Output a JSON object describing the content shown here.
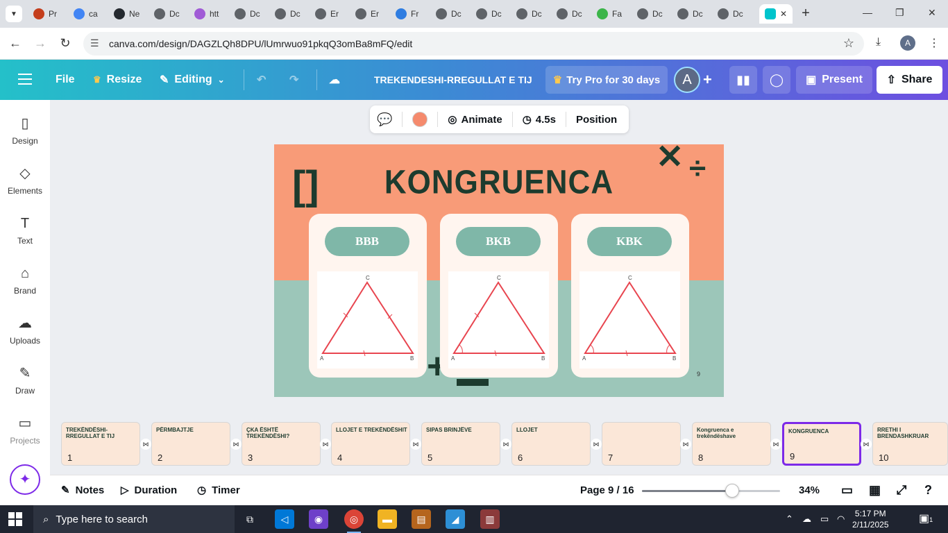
{
  "browser": {
    "tabs": [
      {
        "title": "Pr",
        "icon": "powerpoint-icon",
        "color": "#c43e1c"
      },
      {
        "title": "ca",
        "icon": "google-icon",
        "color": "#4285f4"
      },
      {
        "title": "Ne",
        "icon": "github-icon",
        "color": "#24292f"
      },
      {
        "title": "Dc",
        "icon": "globe-icon",
        "color": "#5f6368"
      },
      {
        "title": "htt",
        "icon": "triangle-icon",
        "color": "#a05bd6"
      },
      {
        "title": "Dc",
        "icon": "globe-icon",
        "color": "#5f6368"
      },
      {
        "title": "Dc",
        "icon": "globe-icon",
        "color": "#5f6368"
      },
      {
        "title": "Er",
        "icon": "globe-icon",
        "color": "#5f6368"
      },
      {
        "title": "Er",
        "icon": "globe-icon",
        "color": "#5f6368"
      },
      {
        "title": "Fr",
        "icon": "heart-icon",
        "color": "#2f7de1"
      },
      {
        "title": "Dc",
        "icon": "globe-icon",
        "color": "#5f6368"
      },
      {
        "title": "Dc",
        "icon": "globe-icon",
        "color": "#5f6368"
      },
      {
        "title": "Dc",
        "icon": "globe-icon",
        "color": "#5f6368"
      },
      {
        "title": "Dc",
        "icon": "globe-icon",
        "color": "#5f6368"
      },
      {
        "title": "Fa",
        "icon": "am-icon",
        "color": "#3cb54a"
      },
      {
        "title": "Dc",
        "icon": "globe-icon",
        "color": "#5f6368"
      },
      {
        "title": "Dc",
        "icon": "globe-icon",
        "color": "#5f6368"
      },
      {
        "title": "Dc",
        "icon": "globe-icon",
        "color": "#5f6368"
      }
    ],
    "active_tab_icon": "canva-icon",
    "url": "canva.com/design/DAGZLQh8DPU/lUmrwuo91pkqQ3omBa8mFQ/edit",
    "profile_initial": "A"
  },
  "header": {
    "file": "File",
    "resize": "Resize",
    "editing": "Editing",
    "title": "TREKENDESHI-RREGULLAT E TIJ",
    "try_pro": "Try Pro for 30 days",
    "avatar": "A",
    "present": "Present",
    "share": "Share",
    "accent": "#7d2ae8"
  },
  "sidebar": {
    "items": [
      {
        "label": "Design",
        "icon": "design-icon"
      },
      {
        "label": "Elements",
        "icon": "elements-icon"
      },
      {
        "label": "Text",
        "icon": "text-icon"
      },
      {
        "label": "Brand",
        "icon": "brand-icon"
      },
      {
        "label": "Uploads",
        "icon": "uploads-icon"
      },
      {
        "label": "Draw",
        "icon": "draw-icon"
      },
      {
        "label": "Projects",
        "icon": "projects-icon"
      }
    ]
  },
  "context_toolbar": {
    "animate": "Animate",
    "duration": "4.5s",
    "position": "Position",
    "fill_color": "#f58a6d"
  },
  "slide": {
    "title": "KONGRUENCA",
    "cards": [
      {
        "label": "BBB",
        "vertices": [
          "A",
          "B",
          "C"
        ]
      },
      {
        "label": "BKB",
        "vertices": [
          "A",
          "B",
          "C"
        ]
      },
      {
        "label": "KBK",
        "vertices": [
          "A",
          "B",
          "C"
        ]
      }
    ],
    "page_number": "9",
    "colors": {
      "top": "#f89b78",
      "bottom": "#9cc6b9",
      "dark": "#1d3b2e",
      "triangle": "#e8454f"
    }
  },
  "thumbnails": [
    {
      "num": "1",
      "text": "TREKËNDËSHI-RREGULLAT E TIJ"
    },
    {
      "num": "2",
      "text": "PËRMBAJTJE"
    },
    {
      "num": "3",
      "text": "ÇKA ËSHTË TREKËNDËSHI?"
    },
    {
      "num": "4",
      "text": "LLOJET E TREKËNDËSHIT"
    },
    {
      "num": "5",
      "text": "SIPAS BRINJËVE"
    },
    {
      "num": "6",
      "text": "LLOJET"
    },
    {
      "num": "7",
      "text": ""
    },
    {
      "num": "8",
      "text": "Kongruenca e trekëndëshave"
    },
    {
      "num": "9",
      "text": "KONGRUENCA"
    },
    {
      "num": "10",
      "text": "RRETHI I BRENDASHKRUAR"
    }
  ],
  "bottombar": {
    "notes": "Notes",
    "duration": "Duration",
    "timer": "Timer",
    "page": "Page 9 / 16",
    "zoom": "34%",
    "zoom_level": 0.34
  },
  "taskbar": {
    "search_placeholder": "Type here to search",
    "time": "5:17 PM",
    "date": "2/11/2025",
    "notifications": "1"
  }
}
